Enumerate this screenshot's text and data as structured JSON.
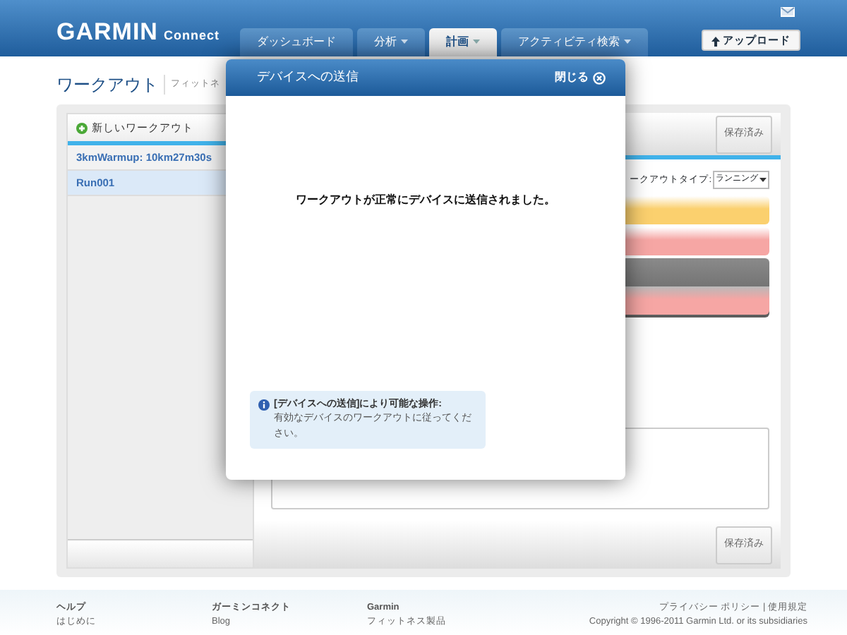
{
  "header": {
    "logo": "GARMIN",
    "logo_sub": "Connect",
    "upload_button": "アップロード",
    "nav": [
      {
        "label": "ダッシュボード",
        "dropdown": false,
        "selected": false
      },
      {
        "label": "分析",
        "dropdown": true,
        "selected": false
      },
      {
        "label": "計画",
        "dropdown": true,
        "selected": true
      },
      {
        "label": "アクティビティ検索",
        "dropdown": true,
        "selected": false
      }
    ]
  },
  "page": {
    "title": "ワークアウト",
    "breadcrumb": "フィットネ"
  },
  "workout_list": {
    "new_button": "新しいワークアウト",
    "items": [
      {
        "label": "3kmWarmup: 10km27m30s",
        "selected": false
      },
      {
        "label": "Run001",
        "selected": true
      }
    ]
  },
  "editor": {
    "save_buttons": [
      "保存済み",
      "保存済み"
    ],
    "workout_type_label": "ークアウトタイプ:",
    "workout_type_value": "ランニング",
    "steps": [
      {
        "kind": "step",
        "color": "#fbd06e"
      },
      {
        "kind": "step",
        "color": "#f6a6a4"
      },
      {
        "kind": "repeat",
        "color": "#5c5c5c",
        "children": [
          {
            "kind": "step",
            "color": "#f6a6a4"
          }
        ]
      }
    ]
  },
  "modal": {
    "title": "デバイスへの送信",
    "close": "閉じる",
    "message": "ワークアウトが正常にデバイスに送信されました。",
    "info_title": "[デバイスへの送信]により可能な操作:",
    "info_text": "有効なデバイスのワークアウトに従ってください。"
  },
  "footer": {
    "columns": [
      {
        "heading": "ヘルプ",
        "link": "はじめに"
      },
      {
        "heading": "ガーミンコネクト",
        "link": "Blog"
      },
      {
        "heading": "Garmin",
        "link": "フィットネス製品"
      }
    ],
    "legal": "プライバシー ポリシー | 使用規定",
    "copyright": "Copyright © 1996-2011 Garmin Ltd. or its subsidiaries"
  }
}
